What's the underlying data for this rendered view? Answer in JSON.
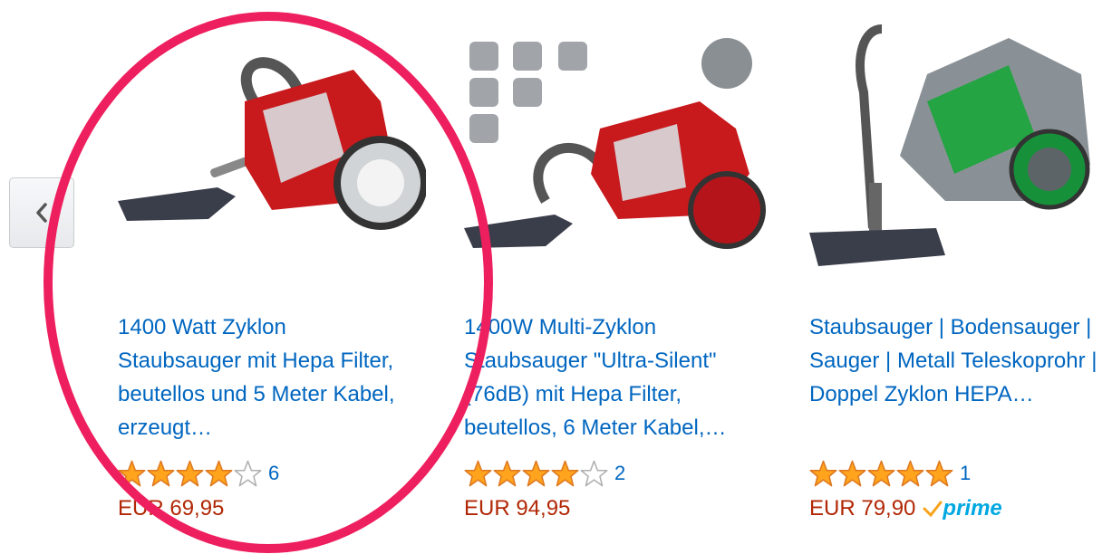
{
  "carousel": {
    "prev_icon": "chevron-left-icon",
    "products": [
      {
        "title": "1400 Watt Zyklon Staubsauger mit Hepa Filter, beutellos und 5 Meter Kabel, erzeugt…",
        "rating": 4,
        "review_count": "6",
        "price": "EUR 69,95",
        "prime": false,
        "color": "red"
      },
      {
        "title": "1400W Multi-Zyklon Staubsauger \"Ultra-Silent\" (76dB) mit Hepa Filter, beutellos, 6 Meter Kabel,…",
        "rating": 4,
        "review_count": "2",
        "price": "EUR 94,95",
        "prime": false,
        "color": "red"
      },
      {
        "title": "Staubsauger | Bodensauger | Sauger | Metall Teleskoprohr | Doppel Zyklon HEPA…",
        "rating": 5,
        "review_count": "1",
        "price": "EUR 79,90",
        "prime": true,
        "prime_label": "prime",
        "color": "green"
      }
    ]
  },
  "colors": {
    "link": "#0066c0",
    "price": "#b12704",
    "star": "#ffa41c",
    "prime": "#00a8e1",
    "highlight": "#ee1f5e"
  }
}
